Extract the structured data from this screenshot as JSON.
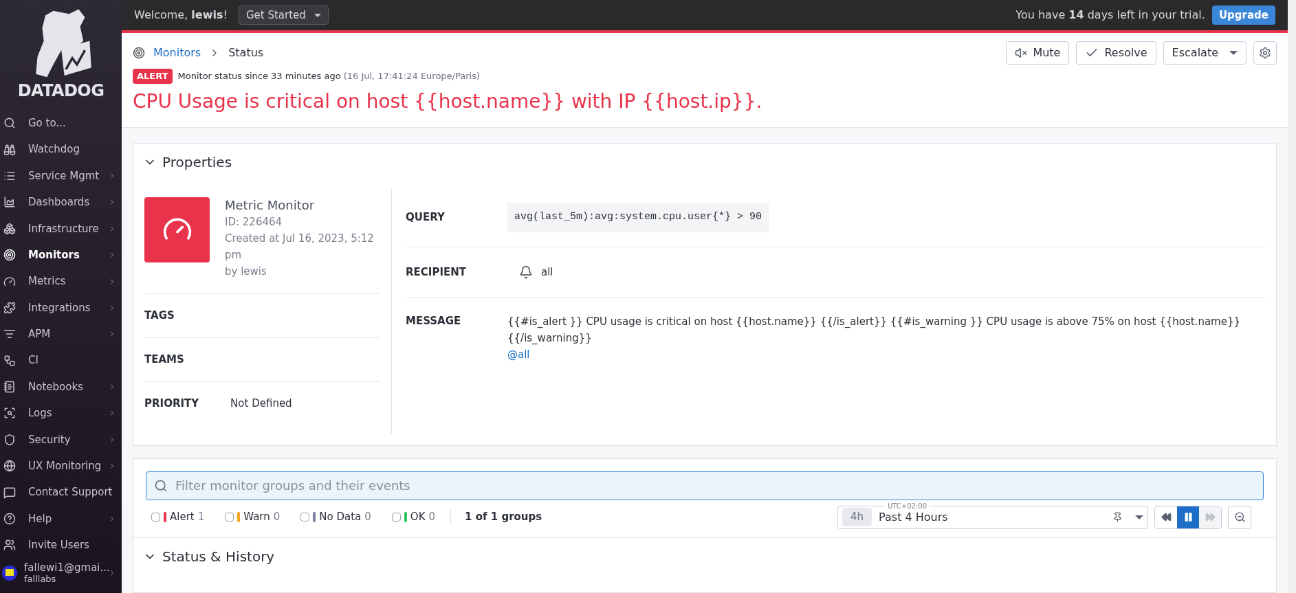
{
  "sidebar": {
    "logo": "DATADOG",
    "items": [
      {
        "label": "Go to...",
        "submenu": false,
        "selected": false
      },
      {
        "label": "Watchdog",
        "submenu": false,
        "selected": false
      },
      {
        "label": "Service Mgmt",
        "submenu": true,
        "selected": false
      },
      {
        "label": "Dashboards",
        "submenu": true,
        "selected": false
      },
      {
        "label": "Infrastructure",
        "submenu": true,
        "selected": false
      },
      {
        "label": "Monitors",
        "submenu": true,
        "selected": true
      },
      {
        "label": "Metrics",
        "submenu": true,
        "selected": false
      },
      {
        "label": "Integrations",
        "submenu": true,
        "selected": false
      },
      {
        "label": "APM",
        "submenu": true,
        "selected": false
      },
      {
        "label": "CI",
        "submenu": false,
        "selected": false
      },
      {
        "label": "Notebooks",
        "submenu": true,
        "selected": false
      },
      {
        "label": "Logs",
        "submenu": true,
        "selected": false
      },
      {
        "label": "Security",
        "submenu": true,
        "selected": false
      },
      {
        "label": "UX Monitoring",
        "submenu": true,
        "selected": false
      },
      {
        "label": "Contact Support",
        "submenu": false,
        "selected": false
      },
      {
        "label": "Help",
        "submenu": true,
        "selected": false
      },
      {
        "label": "Invite Users",
        "submenu": false,
        "selected": false
      }
    ],
    "user": {
      "email": "fallewi1@gmai...",
      "org": "falllabs"
    }
  },
  "top_bar": {
    "welcome": "Welcome, **lewis**!",
    "get_started": "Get Started",
    "trial": "You have **14** days left in your trial.",
    "upgrade": "Upgrade"
  },
  "header": {
    "breadcrumb": [
      "Monitors",
      "Status"
    ],
    "actions": {
      "mute": "Mute",
      "resolve": "Resolve",
      "escalate": "Escalate"
    },
    "status_badge": "ALERT",
    "status_text": "Monitor status since 33 minutes ago",
    "status_time": "(16 Jul, 17:41:24 Europe/Paris)",
    "title": "CPU Usage is critical on host {{host.name}} with IP {{host.ip}}."
  },
  "properties": {
    "title": "Properties",
    "expanded": true,
    "monitor": {
      "type": "Metric Monitor",
      "id": "ID: 226464",
      "created": "Created at Jul 16, 2023, 5:12 pm",
      "by": "by lewis"
    },
    "tags_label": "TAGS",
    "teams_label": "TEAMS",
    "priority_label": "PRIORITY",
    "priority": "Not Defined",
    "query_label": "QUERY",
    "query": "avg(last_5m):avg:system.cpu.user{*} > 90",
    "recipient_label": "RECIPIENT",
    "recipient": "all",
    "message_label": "MESSAGE",
    "message": "{{#is_alert }} CPU usage is critical on host {{host.name}} {{/is_alert}} {{#is_warning }} CPU usage is above 75% on host {{host.name}} {{/is_warning}}",
    "mention": "@all"
  },
  "filter": {
    "placeholder": "Filter monitor groups and their events",
    "statuses": [
      {
        "label": "Alert",
        "count": "1",
        "checked": false,
        "color": "#e8334a"
      },
      {
        "label": "Warn",
        "count": "0",
        "checked": false,
        "color": "#f5a623"
      },
      {
        "label": "No Data",
        "count": "0",
        "checked": false,
        "color": "#7c82a0"
      },
      {
        "label": "OK",
        "count": "0",
        "checked": false,
        "color": "#2ec35a"
      }
    ],
    "groups": "1 of 1 groups",
    "time": {
      "timezone": "UTC+02:00",
      "chip": "4h",
      "range": "Past 4 Hours"
    },
    "paused": true
  },
  "status_history": {
    "title": "Status & History"
  }
}
